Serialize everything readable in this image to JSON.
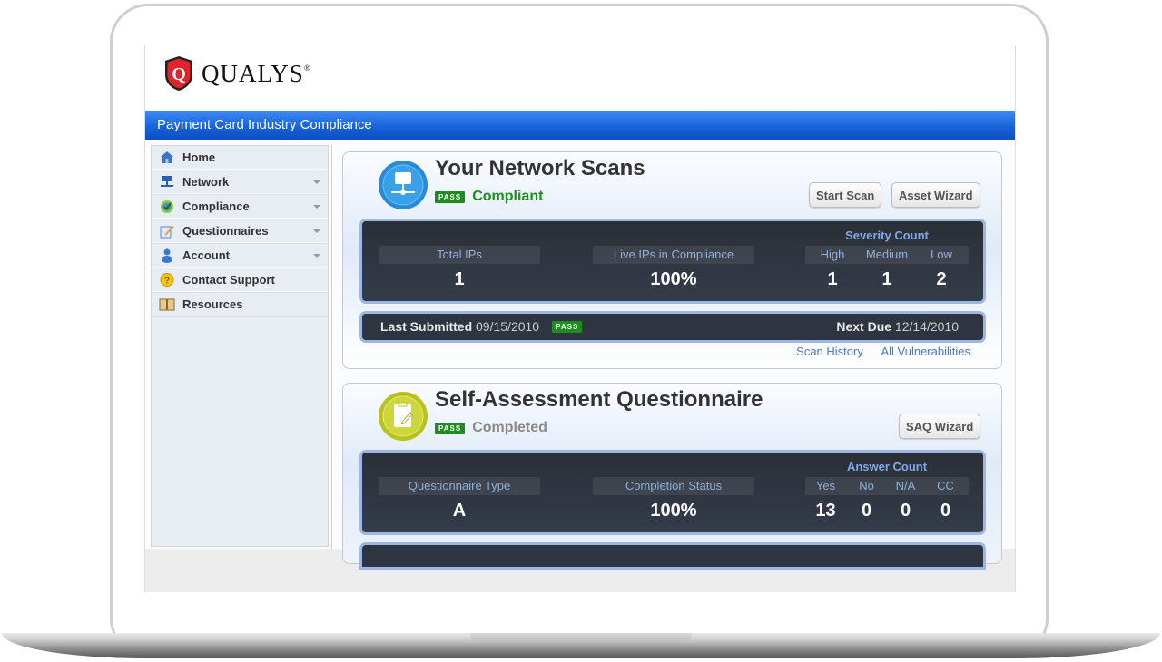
{
  "brand": {
    "name": "QUALYS",
    "registered": "®",
    "logo_letter": "Q"
  },
  "app_bar": {
    "title": "Payment Card Industry Compliance"
  },
  "colors": {
    "accent_blue": "#1660d8",
    "pass_green": "#1e8c1e",
    "compliant_green": "#1e8c1e",
    "completed_gray": "#8a8a8a",
    "link_blue": "#4a78c0"
  },
  "sidebar": {
    "items": [
      {
        "label": "Home",
        "icon": "home-icon",
        "has_dropdown": false
      },
      {
        "label": "Network",
        "icon": "network-icon",
        "has_dropdown": true
      },
      {
        "label": "Compliance",
        "icon": "checkmark-icon",
        "has_dropdown": true
      },
      {
        "label": "Questionnaires",
        "icon": "questionnaire-icon",
        "has_dropdown": true
      },
      {
        "label": "Account",
        "icon": "user-icon",
        "has_dropdown": true
      },
      {
        "label": "Contact Support",
        "icon": "help-icon",
        "has_dropdown": false
      },
      {
        "label": "Resources",
        "icon": "book-icon",
        "has_dropdown": false
      }
    ]
  },
  "network_scans": {
    "title": "Your Network Scans",
    "badge": "PASS",
    "status": "Compliant",
    "buttons": {
      "start_scan": "Start Scan",
      "asset_wizard": "Asset Wizard"
    },
    "stats": {
      "total_ips_label": "Total IPs",
      "total_ips_value": "1",
      "live_ips_label": "Live IPs in Compliance",
      "live_ips_value": "100%"
    },
    "severity": {
      "title": "Severity Count",
      "columns": [
        {
          "label": "High",
          "value": "1"
        },
        {
          "label": "Medium",
          "value": "1"
        },
        {
          "label": "Low",
          "value": "2"
        }
      ]
    },
    "last_submitted_label": "Last Submitted",
    "last_submitted_date": "09/15/2010",
    "last_submitted_badge": "PASS",
    "next_due_label": "Next Due",
    "next_due_date": "12/14/2010",
    "links": {
      "scan_history": "Scan History",
      "all_vulnerabilities": "All Vulnerabilities"
    }
  },
  "saq": {
    "title": "Self-Assessment Questionnaire",
    "badge": "PASS",
    "status": "Completed",
    "buttons": {
      "saq_wizard": "SAQ Wizard"
    },
    "stats": {
      "type_label": "Questionnaire Type",
      "type_value": "A",
      "completion_label": "Completion Status",
      "completion_value": "100%"
    },
    "answers": {
      "title": "Answer Count",
      "columns": [
        {
          "label": "Yes",
          "value": "13"
        },
        {
          "label": "No",
          "value": "0"
        },
        {
          "label": "N/A",
          "value": "0"
        },
        {
          "label": "CC",
          "value": "0"
        }
      ]
    }
  }
}
